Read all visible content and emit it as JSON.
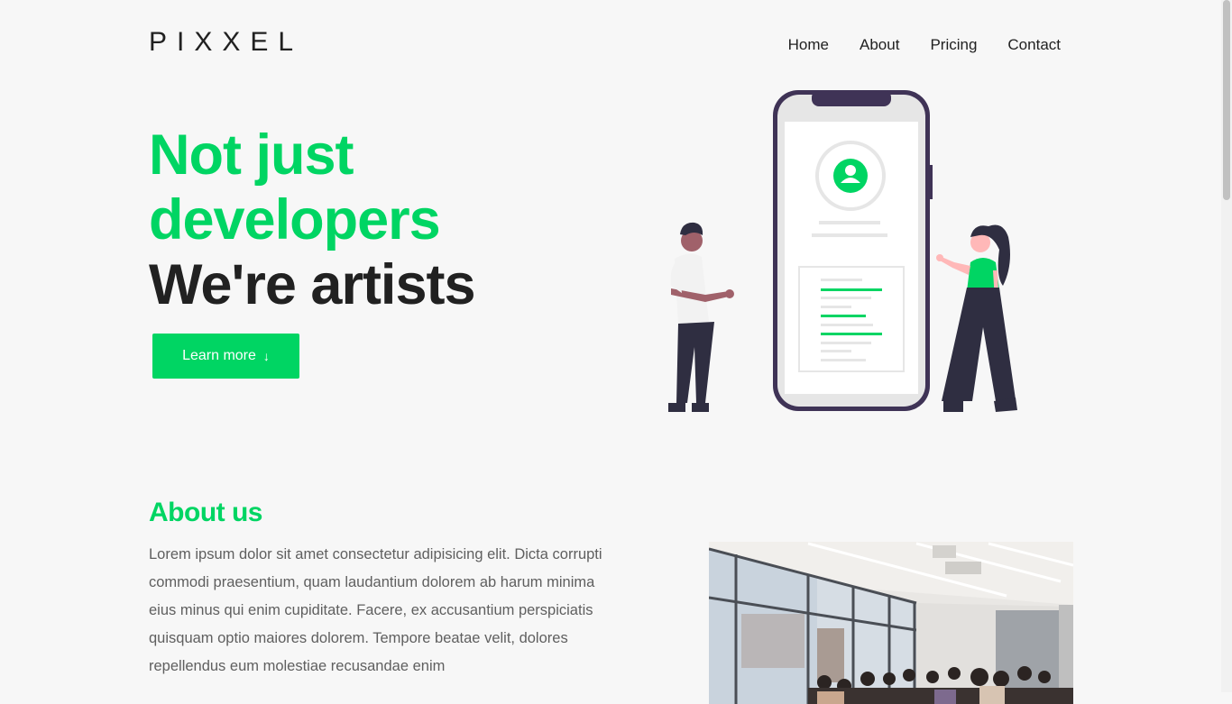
{
  "brand": {
    "logo": "PIXXEL"
  },
  "nav": {
    "items": [
      "Home",
      "About",
      "Pricing",
      "Contact"
    ]
  },
  "hero": {
    "title_line1": "Not just",
    "title_line2": "developers",
    "title_line3": "We're artists",
    "cta_label": "Learn more",
    "cta_icon": "arrow-down-icon"
  },
  "about": {
    "heading": "About us",
    "body": "Lorem ipsum dolor sit amet consectetur adipisicing elit. Dicta corrupti commodi praesentium, quam laudantium dolorem ab harum minima eius minus qui enim cupiditate. Facere, ex accusantium perspiciatis quisquam optio maiores dolorem. Tempore beatae velit, dolores repellendus eum molestiae recusandae enim"
  },
  "colors": {
    "accent": "#00d563",
    "text": "#212121",
    "muted": "#5f5f5f",
    "background": "#f7f7f7",
    "illustration_dark": "#3f3356"
  }
}
